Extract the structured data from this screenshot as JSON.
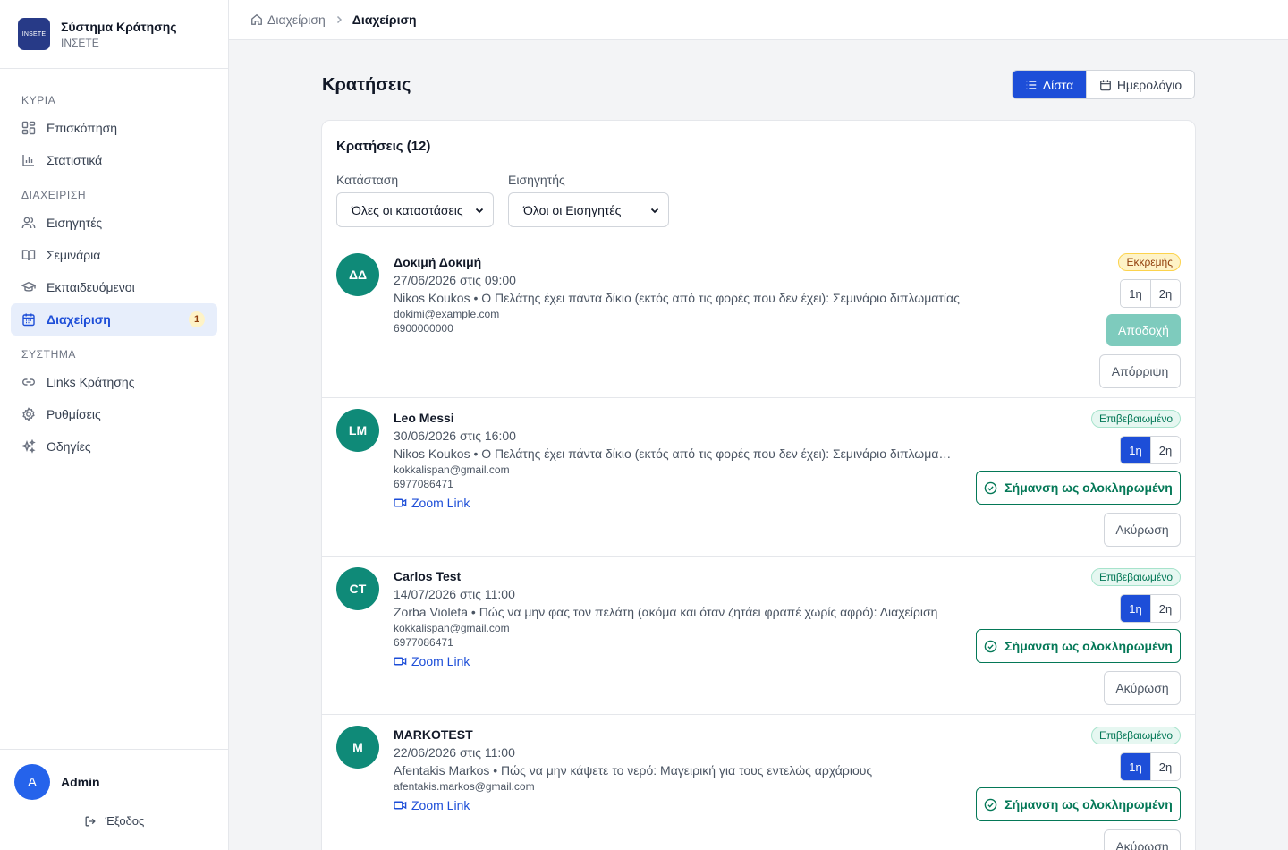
{
  "app": {
    "title": "Σύστημα Κράτησης",
    "subtitle": "INΣΕΤΕ",
    "logo_text": "INSETE"
  },
  "sidebar": {
    "sections": [
      {
        "label": "ΚΥΡΙΑ",
        "items": [
          {
            "label": "Επισκόπηση",
            "icon": "grid-icon"
          },
          {
            "label": "Στατιστικά",
            "icon": "bar-chart-icon"
          }
        ]
      },
      {
        "label": "ΔΙΑΧΕΙΡΙΣΗ",
        "items": [
          {
            "label": "Εισηγητές",
            "icon": "users-icon"
          },
          {
            "label": "Σεμινάρια",
            "icon": "book-icon"
          },
          {
            "label": "Εκπαιδευόμενοι",
            "icon": "graduation-cap-icon"
          },
          {
            "label": "Διαχείριση",
            "icon": "calendar-icon",
            "active": true,
            "badge": "1"
          }
        ]
      },
      {
        "label": "ΣΥΣΤΗΜΑ",
        "items": [
          {
            "label": "Links Κράτησης",
            "icon": "link-icon"
          },
          {
            "label": "Ρυθμίσεις",
            "icon": "gear-icon"
          },
          {
            "label": "Οδηγίες",
            "icon": "sparkles-icon"
          }
        ]
      }
    ],
    "user": {
      "initial": "A",
      "name": "Admin"
    },
    "logout": "Έξοδος"
  },
  "breadcrumb": {
    "home": "Διαχείριση",
    "current": "Διαχείριση"
  },
  "page": {
    "title": "Κρατήσεις"
  },
  "view_toggle": {
    "list": "Λίστα",
    "calendar": "Ημερολόγιο",
    "selected": "list"
  },
  "card": {
    "title": "Κρατήσεις (12)",
    "filters": {
      "status": {
        "label": "Κατάσταση",
        "value": "Όλες οι καταστάσεις"
      },
      "instructor": {
        "label": "Εισηγητής",
        "value": "Όλοι οι Εισηγητές"
      }
    }
  },
  "labels": {
    "accept": "Αποδοχή",
    "reject": "Απόρριψη",
    "complete": "Σήμανση ως ολοκληρωμένη",
    "cancel": "Ακύρωση",
    "zoom": "Zoom Link",
    "session1": "1η",
    "session2": "2η"
  },
  "bookings": [
    {
      "initials": "ΔΔ",
      "name": "Δοκιμή Δοκιμή",
      "datetime": "27/06/2026 στις 09:00",
      "description": "Nikos Koukos • Ο Πελάτης έχει πάντα δίκιο (εκτός από τις φορές που δεν έχει): Σεμινάριο διπλωματίας",
      "email": "dokimi@example.com",
      "phone": "6900000000",
      "status": "Εκκρεμής"
    },
    {
      "initials": "LM",
      "name": "Leo Messi",
      "datetime": "30/06/2026 στις 16:00",
      "description": "Nikos Koukos • Ο Πελάτης έχει πάντα δίκιο (εκτός από τις φορές που δεν έχει): Σεμινάριο διπλωματίας",
      "email": "kokkalispan@gmail.com",
      "phone": "6977086471",
      "status": "Επιβεβαιωμένο"
    },
    {
      "initials": "CT",
      "name": "Carlos Test",
      "datetime": "14/07/2026 στις 11:00",
      "description": "Zorba Violeta • Πώς να μην φας τον πελάτη (ακόμα και όταν ζητάει φραπέ χωρίς αφρό): Διαχείριση",
      "email": "kokkalispan@gmail.com",
      "phone": "6977086471",
      "status": "Επιβεβαιωμένο"
    },
    {
      "initials": "M",
      "name": "MARKOTEST",
      "datetime": "22/06/2026 στις 11:00",
      "description": "Afentakis Markos • Πώς να μην κάψετε το νερό: Μαγειρική για τους εντελώς αρχάριους",
      "email": "afentakis.markos@gmail.com",
      "status": "Επιβεβαιωμένο"
    }
  ]
}
